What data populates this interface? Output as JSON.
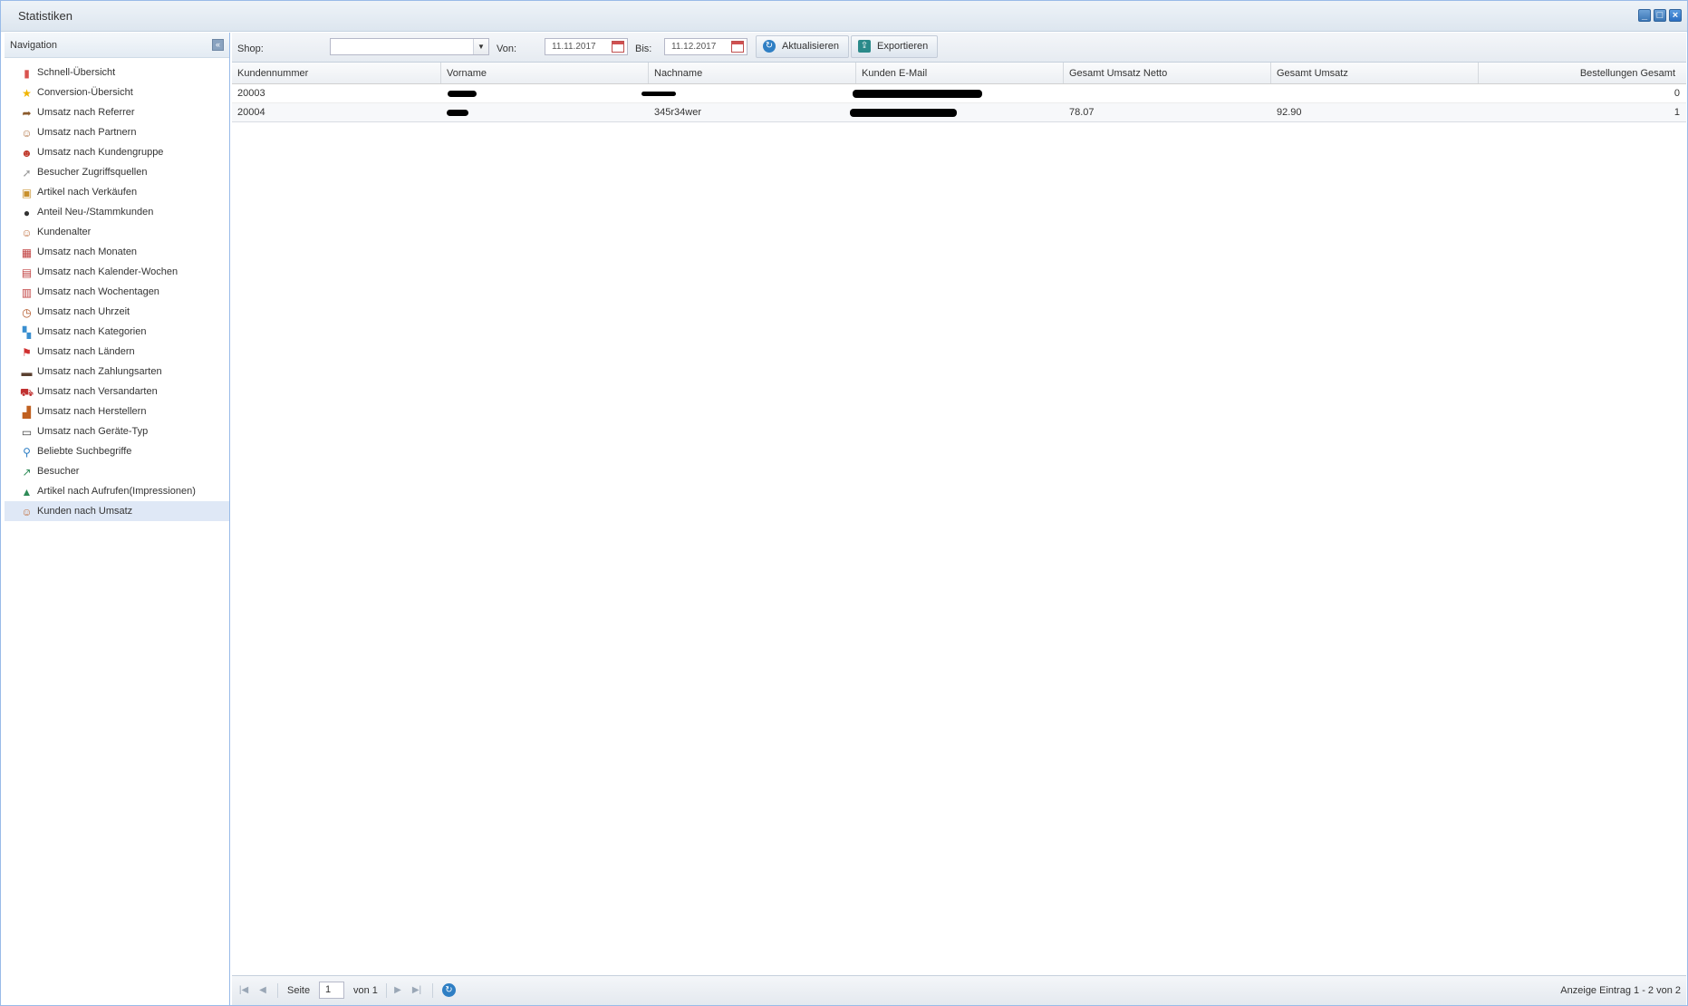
{
  "window": {
    "title": "Statistiken"
  },
  "nav": {
    "header": "Navigation",
    "items": [
      {
        "label": "Schnell-Übersicht",
        "icon": "bar-chart-icon"
      },
      {
        "label": "Conversion-Übersicht",
        "icon": "star-icon"
      },
      {
        "label": "Umsatz nach Referrer",
        "icon": "arrow-icon"
      },
      {
        "label": "Umsatz nach Partnern",
        "icon": "person-icon"
      },
      {
        "label": "Umsatz nach Kundengruppe",
        "icon": "group-icon"
      },
      {
        "label": "Besucher Zugriffsquellen",
        "icon": "cursor-icon"
      },
      {
        "label": "Artikel nach Verkäufen",
        "icon": "package-icon"
      },
      {
        "label": "Anteil Neu-/Stammkunden",
        "icon": "user-dark-icon"
      },
      {
        "label": "Kundenalter",
        "icon": "user-icon"
      },
      {
        "label": "Umsatz nach Monaten",
        "icon": "calendar-icon"
      },
      {
        "label": "Umsatz nach Kalender-Wochen",
        "icon": "calendar-week-icon"
      },
      {
        "label": "Umsatz nach Wochentagen",
        "icon": "calendar-day-icon"
      },
      {
        "label": "Umsatz nach Uhrzeit",
        "icon": "clock-icon"
      },
      {
        "label": "Umsatz nach Kategorien",
        "icon": "category-icon"
      },
      {
        "label": "Umsatz nach Ländern",
        "icon": "flag-icon"
      },
      {
        "label": "Umsatz nach Zahlungsarten",
        "icon": "credit-card-icon"
      },
      {
        "label": "Umsatz nach Versandarten",
        "icon": "truck-icon"
      },
      {
        "label": "Umsatz nach Herstellern",
        "icon": "factory-icon"
      },
      {
        "label": "Umsatz nach Geräte-Typ",
        "icon": "devices-icon"
      },
      {
        "label": "Beliebte Suchbegriffe",
        "icon": "magnifier-icon"
      },
      {
        "label": "Besucher",
        "icon": "trend-line-icon"
      },
      {
        "label": "Artikel nach Aufrufen(Impressionen)",
        "icon": "chart-growth-icon"
      },
      {
        "label": "Kunden nach Umsatz",
        "icon": "customer-icon",
        "selected": true
      }
    ]
  },
  "toolbar": {
    "shop_label": "Shop:",
    "shop_value": "",
    "von_label": "Von:",
    "von_value": "11.11.2017",
    "bis_label": "Bis:",
    "bis_value": "11.12.2017",
    "refresh_label": "Aktualisieren",
    "export_label": "Exportieren"
  },
  "grid": {
    "columns": [
      "Kundennummer",
      "Vorname",
      "Nachname",
      "Kunden E-Mail",
      "Gesamt Umsatz Netto",
      "Gesamt Umsatz",
      "Bestellungen Gesamt"
    ],
    "rows": [
      {
        "kundennummer": "20003",
        "vorname": "",
        "nachname": "",
        "email": "",
        "netto": "",
        "umsatz": "",
        "bestellungen": "0"
      },
      {
        "kundennummer": "20004",
        "vorname": "",
        "nachname": "345r34wer",
        "email": "",
        "netto": "78.07",
        "umsatz": "92.90",
        "bestellungen": "1"
      }
    ]
  },
  "paging": {
    "page_label": "Seite",
    "page_value": "1",
    "of_label": "von 1",
    "info": "Anzeige Eintrag 1 - 2 von 2"
  }
}
